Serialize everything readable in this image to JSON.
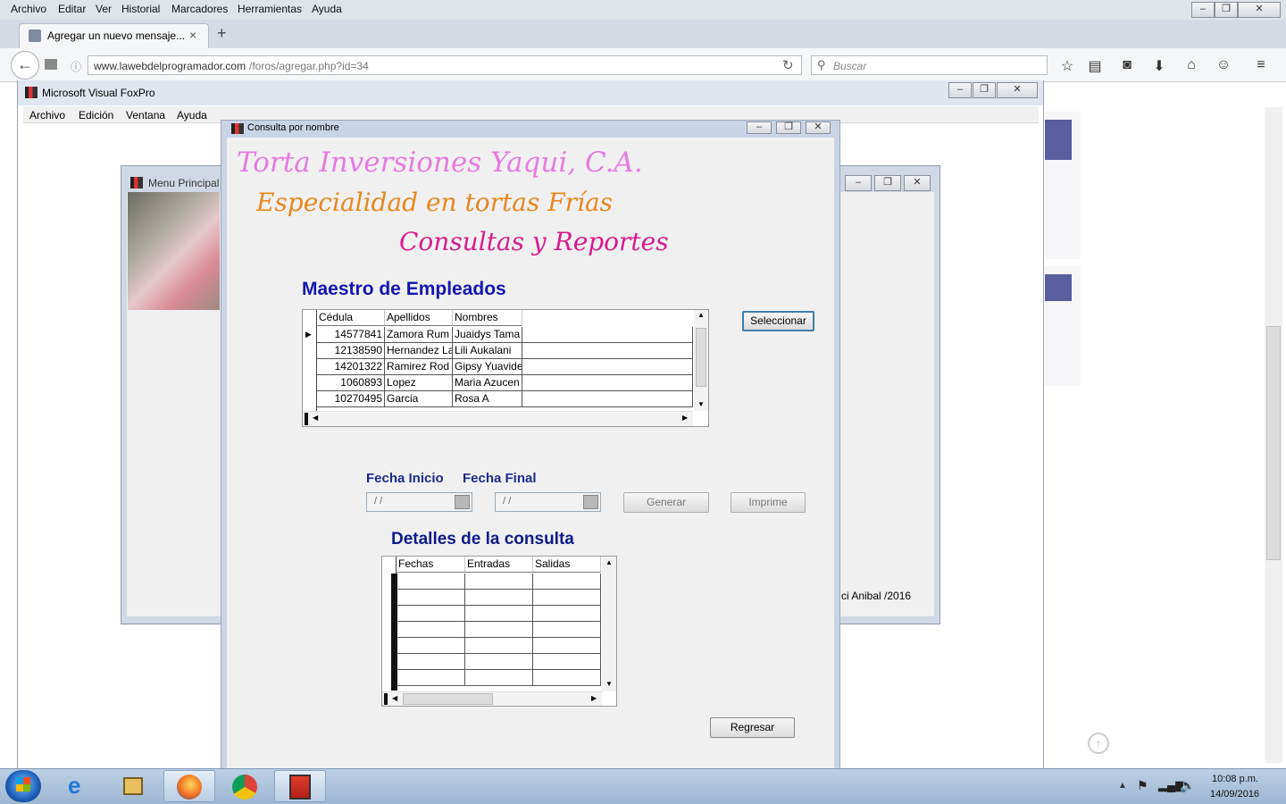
{
  "firefox": {
    "menu": [
      "Archivo",
      "Editar",
      "Ver",
      "Historial",
      "Marcadores",
      "Herramientas",
      "Ayuda"
    ],
    "tab_title": "Agregar un nuevo mensaje...",
    "tab_close": "×",
    "new_tab": "+",
    "url_host": "www.lawebdelprogramador.com",
    "url_path": "/foros/agregar.php?id=34",
    "search_placeholder": "Buscar"
  },
  "vfp": {
    "title": "Microsoft Visual FoxPro",
    "menu": [
      "Archivo",
      "Edición",
      "Ventana",
      "Ayuda"
    ]
  },
  "menu_principal": {
    "title": "Menu Principal",
    "footer": "ci Anibal /2016"
  },
  "consulta": {
    "title": "Consulta por nombre",
    "brand": "Torta Inversiones Yaqui, C.A.",
    "tagline": "Especialidad en tortas Frías",
    "section": "Consultas y Reportes",
    "master_heading": "Maestro de Empleados",
    "select_button": "Seleccionar",
    "employees": {
      "columns": [
        "Cédula",
        "Apellidos",
        "Nombres"
      ],
      "rows": [
        {
          "cedula": "14577841",
          "apellidos": "Zamora Rum",
          "nombres": "Juaidys Tama"
        },
        {
          "cedula": "12138590",
          "apellidos": "Hernandez La",
          "nombres": "Lili Aukalani"
        },
        {
          "cedula": "14201322",
          "apellidos": "Ramirez Rod",
          "nombres": "Gipsy Yuavide"
        },
        {
          "cedula": "1060893",
          "apellidos": "Lopez",
          "nombres": "Maria Azucen"
        },
        {
          "cedula": "10270495",
          "apellidos": "Garcia",
          "nombres": "Rosa A"
        }
      ]
    },
    "fecha_inicio_label": "Fecha Inicio",
    "fecha_final_label": "Fecha Final",
    "fecha_inicio_value": "/ /",
    "fecha_final_value": "/ /",
    "generar_button": "Generar",
    "imprime_button": "Imprime",
    "details_heading": "Detalles de la consulta",
    "details_columns": [
      "Fechas",
      "Entradas",
      "Salidas"
    ],
    "regresar_button": "Regresar"
  },
  "taskbar": {
    "time": "10:08 p.m.",
    "date": "14/09/2016"
  },
  "colors": {
    "brand": "#e57be0",
    "tagline": "#e8871e",
    "section": "#d81b8f",
    "heading": "#1414b4",
    "details_heading": "#0c1a8c"
  }
}
